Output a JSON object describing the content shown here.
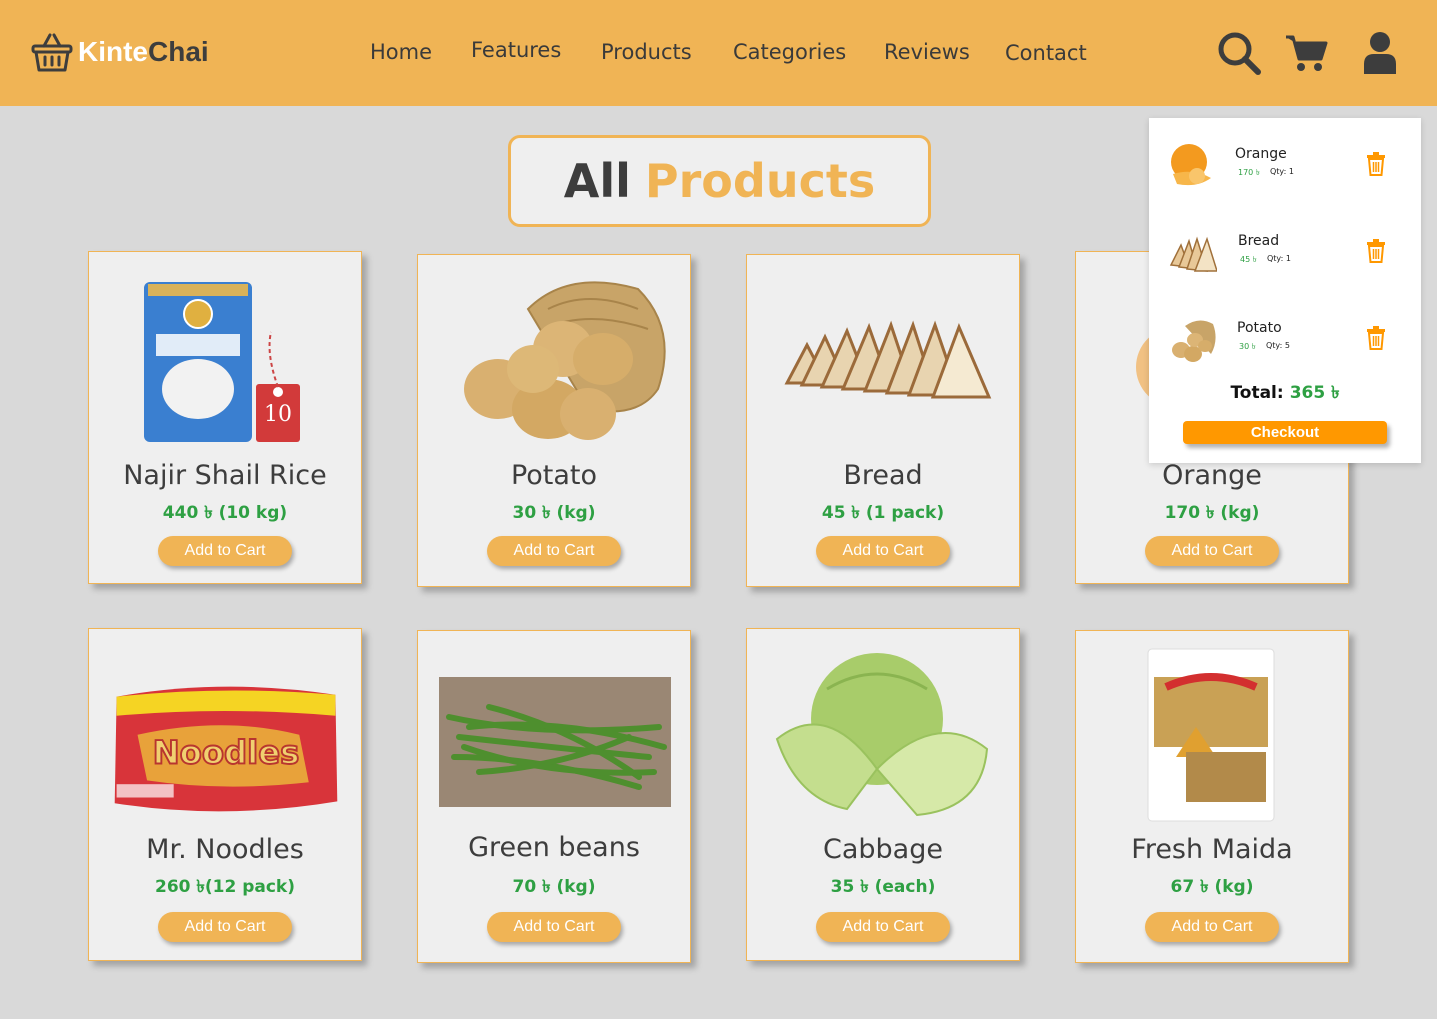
{
  "brand": {
    "part1": "Kinte",
    "part2": "Chai"
  },
  "nav": [
    "Home",
    "Features",
    "Products",
    "Categories",
    "Reviews",
    "Contact"
  ],
  "header_icons": [
    "search-icon",
    "cart-icon",
    "user-icon"
  ],
  "title": {
    "part1": "All",
    "part2": "Products"
  },
  "products": [
    {
      "name": "Najir Shail Rice",
      "price": "440 ৳ (10 kg)",
      "button": "Add to Cart",
      "image": "rice-bag"
    },
    {
      "name": "Potato",
      "price": "30 ৳ (kg)",
      "button": "Add to Cart",
      "image": "potato"
    },
    {
      "name": "Bread",
      "price": "45 ৳ (1 pack)",
      "button": "Add to Cart",
      "image": "bread"
    },
    {
      "name": "Orange",
      "price": "170 ৳ (kg)",
      "button": "Add to Cart",
      "image": "orange"
    },
    {
      "name": "Mr. Noodles",
      "price": "260 ৳(12 pack)",
      "button": "Add to Cart",
      "image": "noodles"
    },
    {
      "name": "Green beans",
      "price": "70 ৳ (kg)",
      "button": "Add to Cart",
      "image": "green-beans"
    },
    {
      "name": "Cabbage",
      "price": "35 ৳ (each)",
      "button": "Add to Cart",
      "image": "cabbage"
    },
    {
      "name": "Fresh Maida",
      "price": "67 ৳ (kg)",
      "button": "Add to Cart",
      "image": "maida"
    }
  ],
  "cart": {
    "items": [
      {
        "name": "Orange",
        "price": "170 ৳",
        "qty": "Qty: 1"
      },
      {
        "name": "Bread",
        "price": "45 ৳",
        "qty": "Qty: 1"
      },
      {
        "name": "Potato",
        "price": "30 ৳",
        "qty": "Qty: 5"
      }
    ],
    "total_label": "Total:",
    "total_value": "365 ৳",
    "checkout": "Checkout"
  },
  "colors": {
    "accent": "#f0b455",
    "price": "#2ea043",
    "checkout": "#ff9800",
    "background": "#d9d9d9"
  },
  "rice_tag": "10"
}
